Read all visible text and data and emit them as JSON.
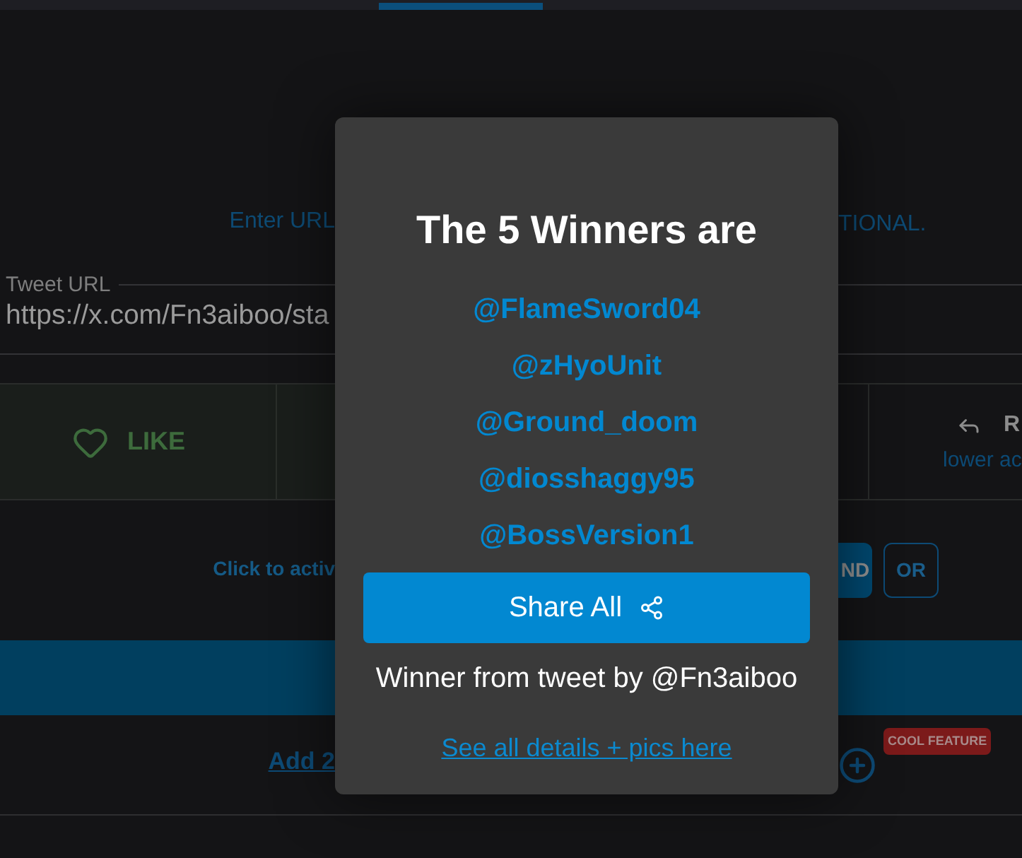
{
  "instructions": [
    "Enter URL",
    "TIONAL."
  ],
  "url_field": {
    "label": "Tweet URL",
    "value": "https://x.com/Fn3aiboo/sta"
  },
  "actions": [
    {
      "kind": "like",
      "label": "LIKE"
    },
    {
      "kind": "reply",
      "label": "R",
      "caption": "lower ac"
    }
  ],
  "mode": {
    "hint": "Click to activ",
    "options": [
      {
        "label": "ND",
        "selected": true
      },
      {
        "label": "OR",
        "selected": false
      }
    ]
  },
  "extras": {
    "link": "Add 2",
    "badge": "COOL FEATURE"
  },
  "dialog": {
    "title": "The 5 Winners are",
    "winners": [
      "@FlameSword04",
      "@zHyoUnit",
      "@Ground_doom",
      "@diosshaggy95",
      "@BossVersion1"
    ],
    "share_button": "Share All",
    "source": "Winner from tweet by @Fn3aiboo",
    "details_link": "See all details + pics here"
  }
}
